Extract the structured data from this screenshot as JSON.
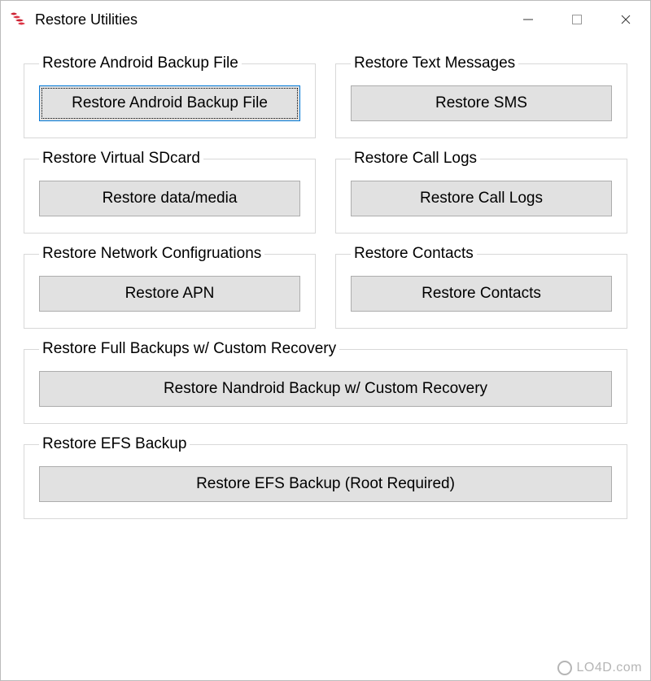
{
  "window": {
    "title": "Restore Utilities"
  },
  "groups": {
    "androidBackup": {
      "legend": "Restore Android Backup File",
      "button": "Restore Android Backup File"
    },
    "textMessages": {
      "legend": "Restore Text Messages",
      "button": "Restore SMS"
    },
    "virtualSdcard": {
      "legend": "Restore Virtual SDcard",
      "button": "Restore data/media"
    },
    "callLogs": {
      "legend": "Restore Call Logs",
      "button": "Restore Call Logs"
    },
    "networkConfig": {
      "legend": "Restore Network Configruations",
      "button": "Restore APN"
    },
    "contacts": {
      "legend": "Restore Contacts",
      "button": "Restore Contacts"
    },
    "fullBackups": {
      "legend": "Restore Full Backups w/ Custom Recovery",
      "button": "Restore Nandroid Backup w/ Custom Recovery"
    },
    "efsBackup": {
      "legend": "Restore EFS Backup",
      "button": "Restore EFS Backup (Root Required)"
    }
  },
  "watermark": "LO4D.com"
}
